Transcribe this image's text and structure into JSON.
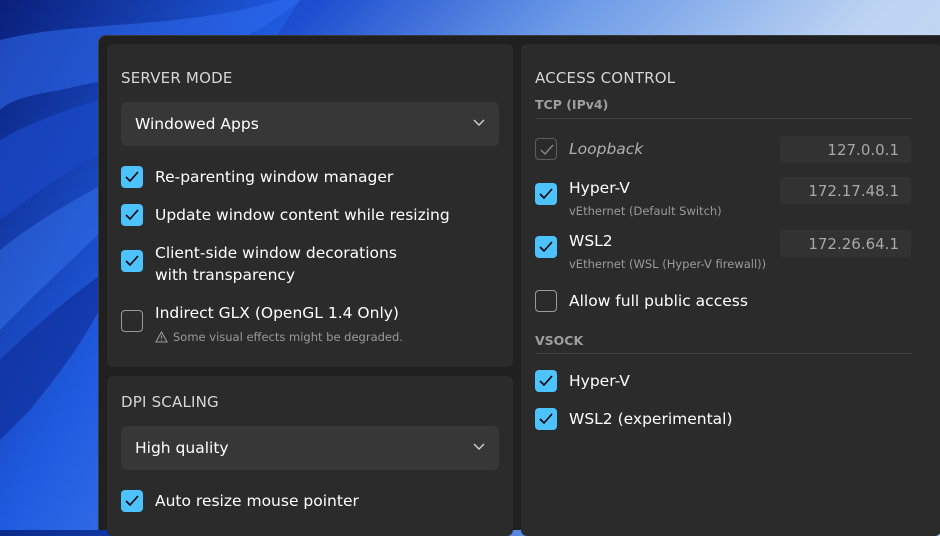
{
  "server_mode": {
    "title": "SERVER MODE",
    "dropdown_value": "Windowed Apps",
    "options": [
      {
        "label": "Re-parenting window manager",
        "checked": true
      },
      {
        "label": "Update window content while resizing",
        "checked": true
      },
      {
        "label_line1": "Client-side window decorations",
        "label_line2": "with transparency",
        "checked": true
      },
      {
        "label": "Indirect GLX (OpenGL 1.4 Only)",
        "checked": false,
        "warning": "Some visual effects might be degraded.",
        "warning_icon": "warning-triangle-icon"
      }
    ]
  },
  "dpi_scaling": {
    "title": "DPI SCALING",
    "dropdown_value": "High quality",
    "options": [
      {
        "label": "Auto resize mouse pointer",
        "checked": true
      }
    ]
  },
  "access_control": {
    "title": "ACCESS CONTROL",
    "tcp": {
      "header": "TCP (IPv4)",
      "items": [
        {
          "label": "Loopback",
          "checked": true,
          "disabled": true,
          "ip": "127.0.0.1"
        },
        {
          "label": "Hyper-V",
          "sub": "vEthernet (Default Switch)",
          "checked": true,
          "ip": "172.17.48.1"
        },
        {
          "label": "WSL2",
          "sub": "vEthernet (WSL (Hyper-V firewall))",
          "checked": true,
          "ip": "172.26.64.1"
        },
        {
          "label": "Allow full public access",
          "checked": false
        }
      ]
    },
    "vsock": {
      "header": "VSOCK",
      "items": [
        {
          "label": "Hyper-V",
          "checked": true
        },
        {
          "label": "WSL2 (experimental)",
          "checked": true
        }
      ]
    }
  },
  "colors": {
    "accent": "#4cc2ff",
    "panel": "#2b2b2b",
    "window": "#202020",
    "input": "#373737"
  }
}
